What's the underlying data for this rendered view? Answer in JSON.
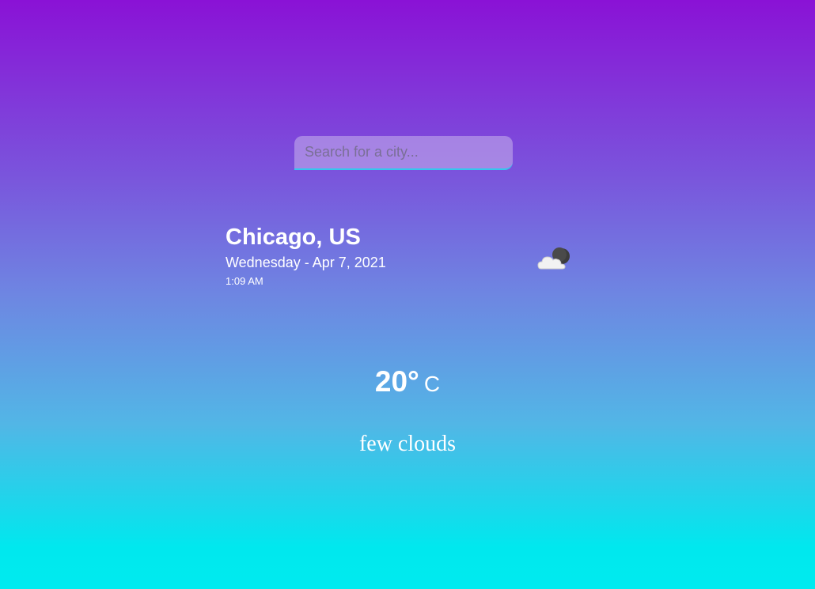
{
  "search": {
    "placeholder": "Search for a city...",
    "value": ""
  },
  "location": {
    "city": "Chicago, US",
    "date": "Wednesday - Apr 7, 2021",
    "time": "1:09 AM"
  },
  "weather": {
    "icon": "few-clouds-night-icon",
    "temperature": "20°",
    "unit": "C",
    "description": "few clouds"
  },
  "colors": {
    "gradient_top": "#8a12d6",
    "gradient_bottom": "#00ebef",
    "text": "#ffffff",
    "search_underline": "#36c6ee"
  }
}
